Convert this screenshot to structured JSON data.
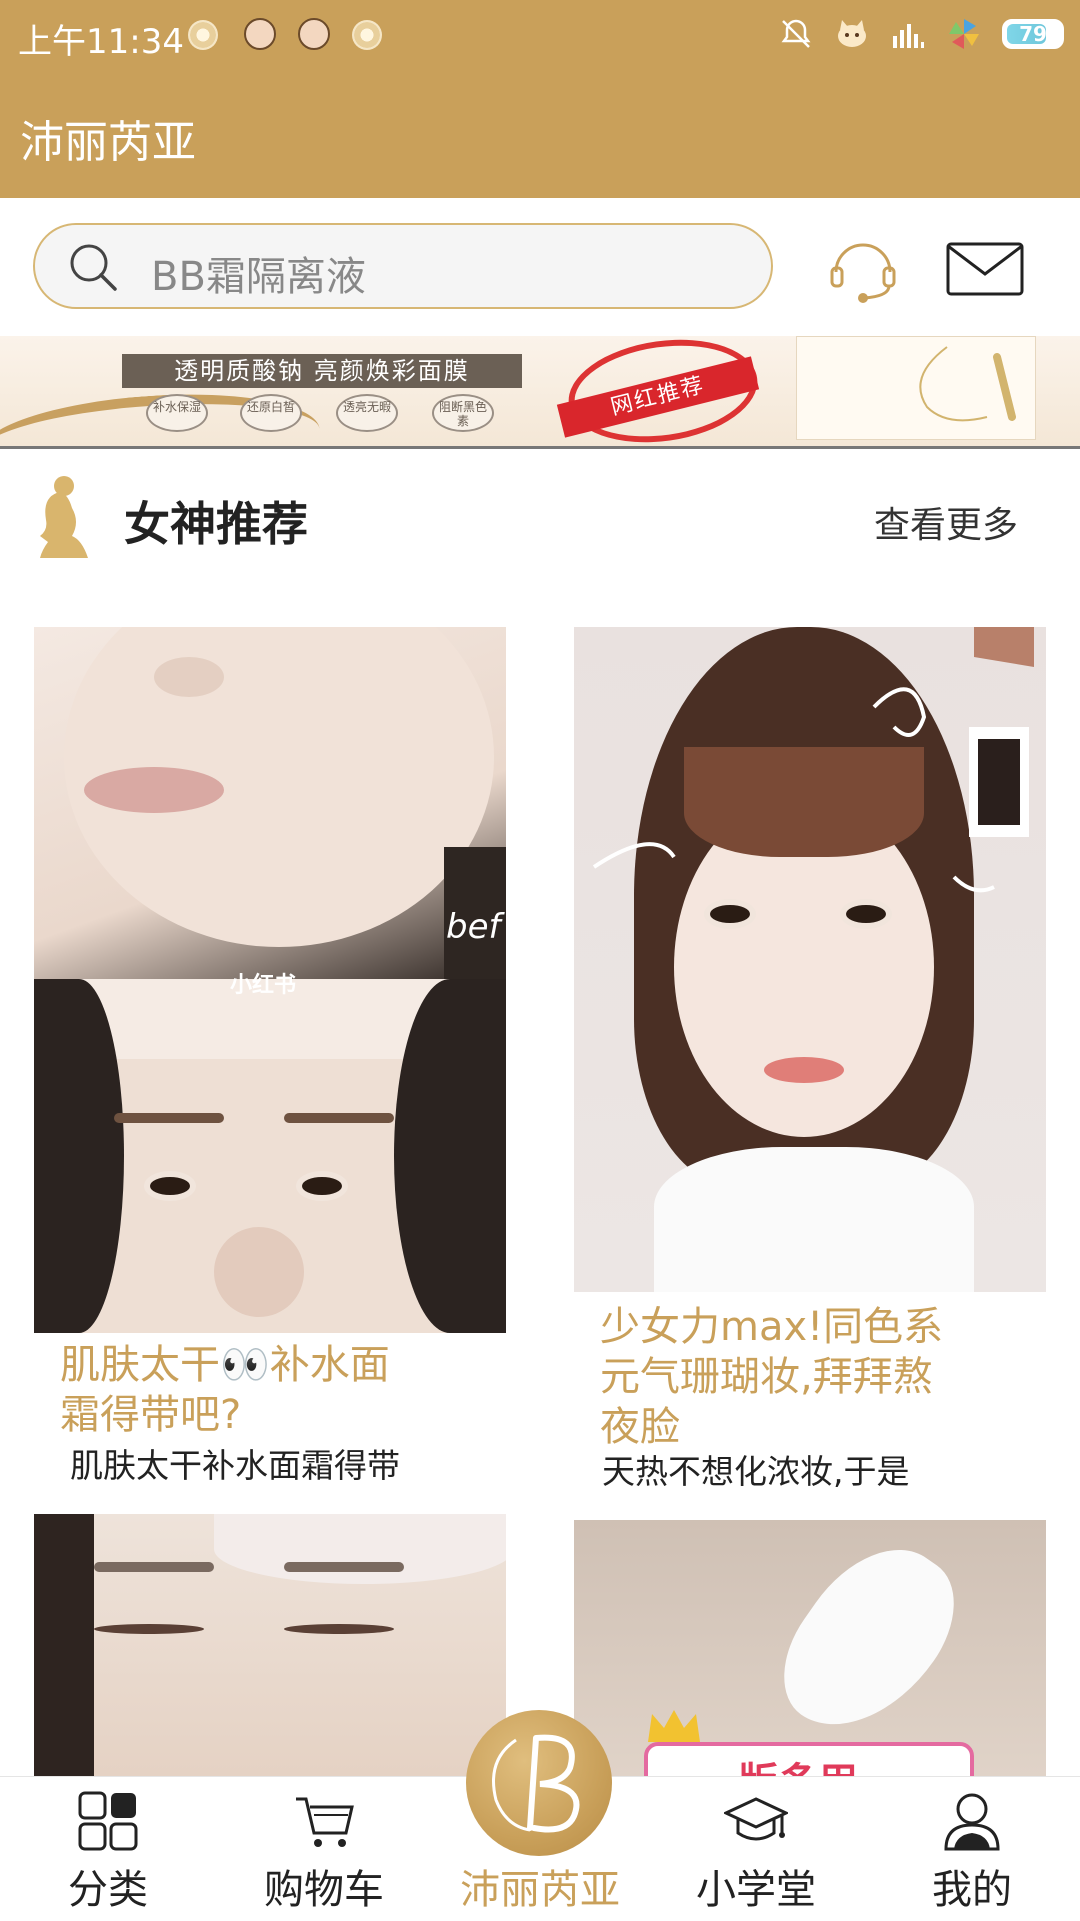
{
  "status_bar": {
    "time": "上午11:34",
    "battery_level": "79"
  },
  "header": {
    "title": "沛丽芮亚"
  },
  "search": {
    "placeholder": "BB霜隔离液"
  },
  "banner": {
    "headline": "透明质酸钠  亮颜焕彩面膜",
    "badges": [
      "补水保湿",
      "还原白皙",
      "透亮无暇",
      "阻断黑色素"
    ],
    "stamp_label": "网红推荐"
  },
  "section": {
    "title": "女神推荐",
    "more_label": "查看更多"
  },
  "cards": [
    {
      "title": "肌肤太干👀补水面霜得带吧?",
      "title_line1": " 肌肤太干👀补水面",
      "title_line2": "霜得带吧?",
      "subtitle": "肌肤太干补水面霜得带",
      "image_watermark": "小红书",
      "image_side_text": "bef"
    },
    {
      "title": "少女力max!同色系元气珊瑚妆,拜拜熬夜脸",
      "title_line1": "少女力max!同色系",
      "title_line2": "元气珊瑚妆,拜拜熬",
      "title_line3": "夜脸",
      "subtitle": "天热不想化浓妆,于是"
    },
    {
      "title": "",
      "subtitle": ""
    },
    {
      "title": "",
      "subtitle": "",
      "image_text": "版多用"
    }
  ],
  "bottom_nav": {
    "items": [
      {
        "label": "分类",
        "icon": "grid-icon"
      },
      {
        "label": "购物车",
        "icon": "cart-icon"
      },
      {
        "label": "沛丽芮亚",
        "icon": "brand-logo-icon",
        "active": true
      },
      {
        "label": "小学堂",
        "icon": "graduation-cap-icon"
      },
      {
        "label": "我的",
        "icon": "user-icon"
      }
    ]
  },
  "colors": {
    "brand_gold": "#c9a05a",
    "search_border": "#d7b774",
    "text_dark": "#222222"
  }
}
